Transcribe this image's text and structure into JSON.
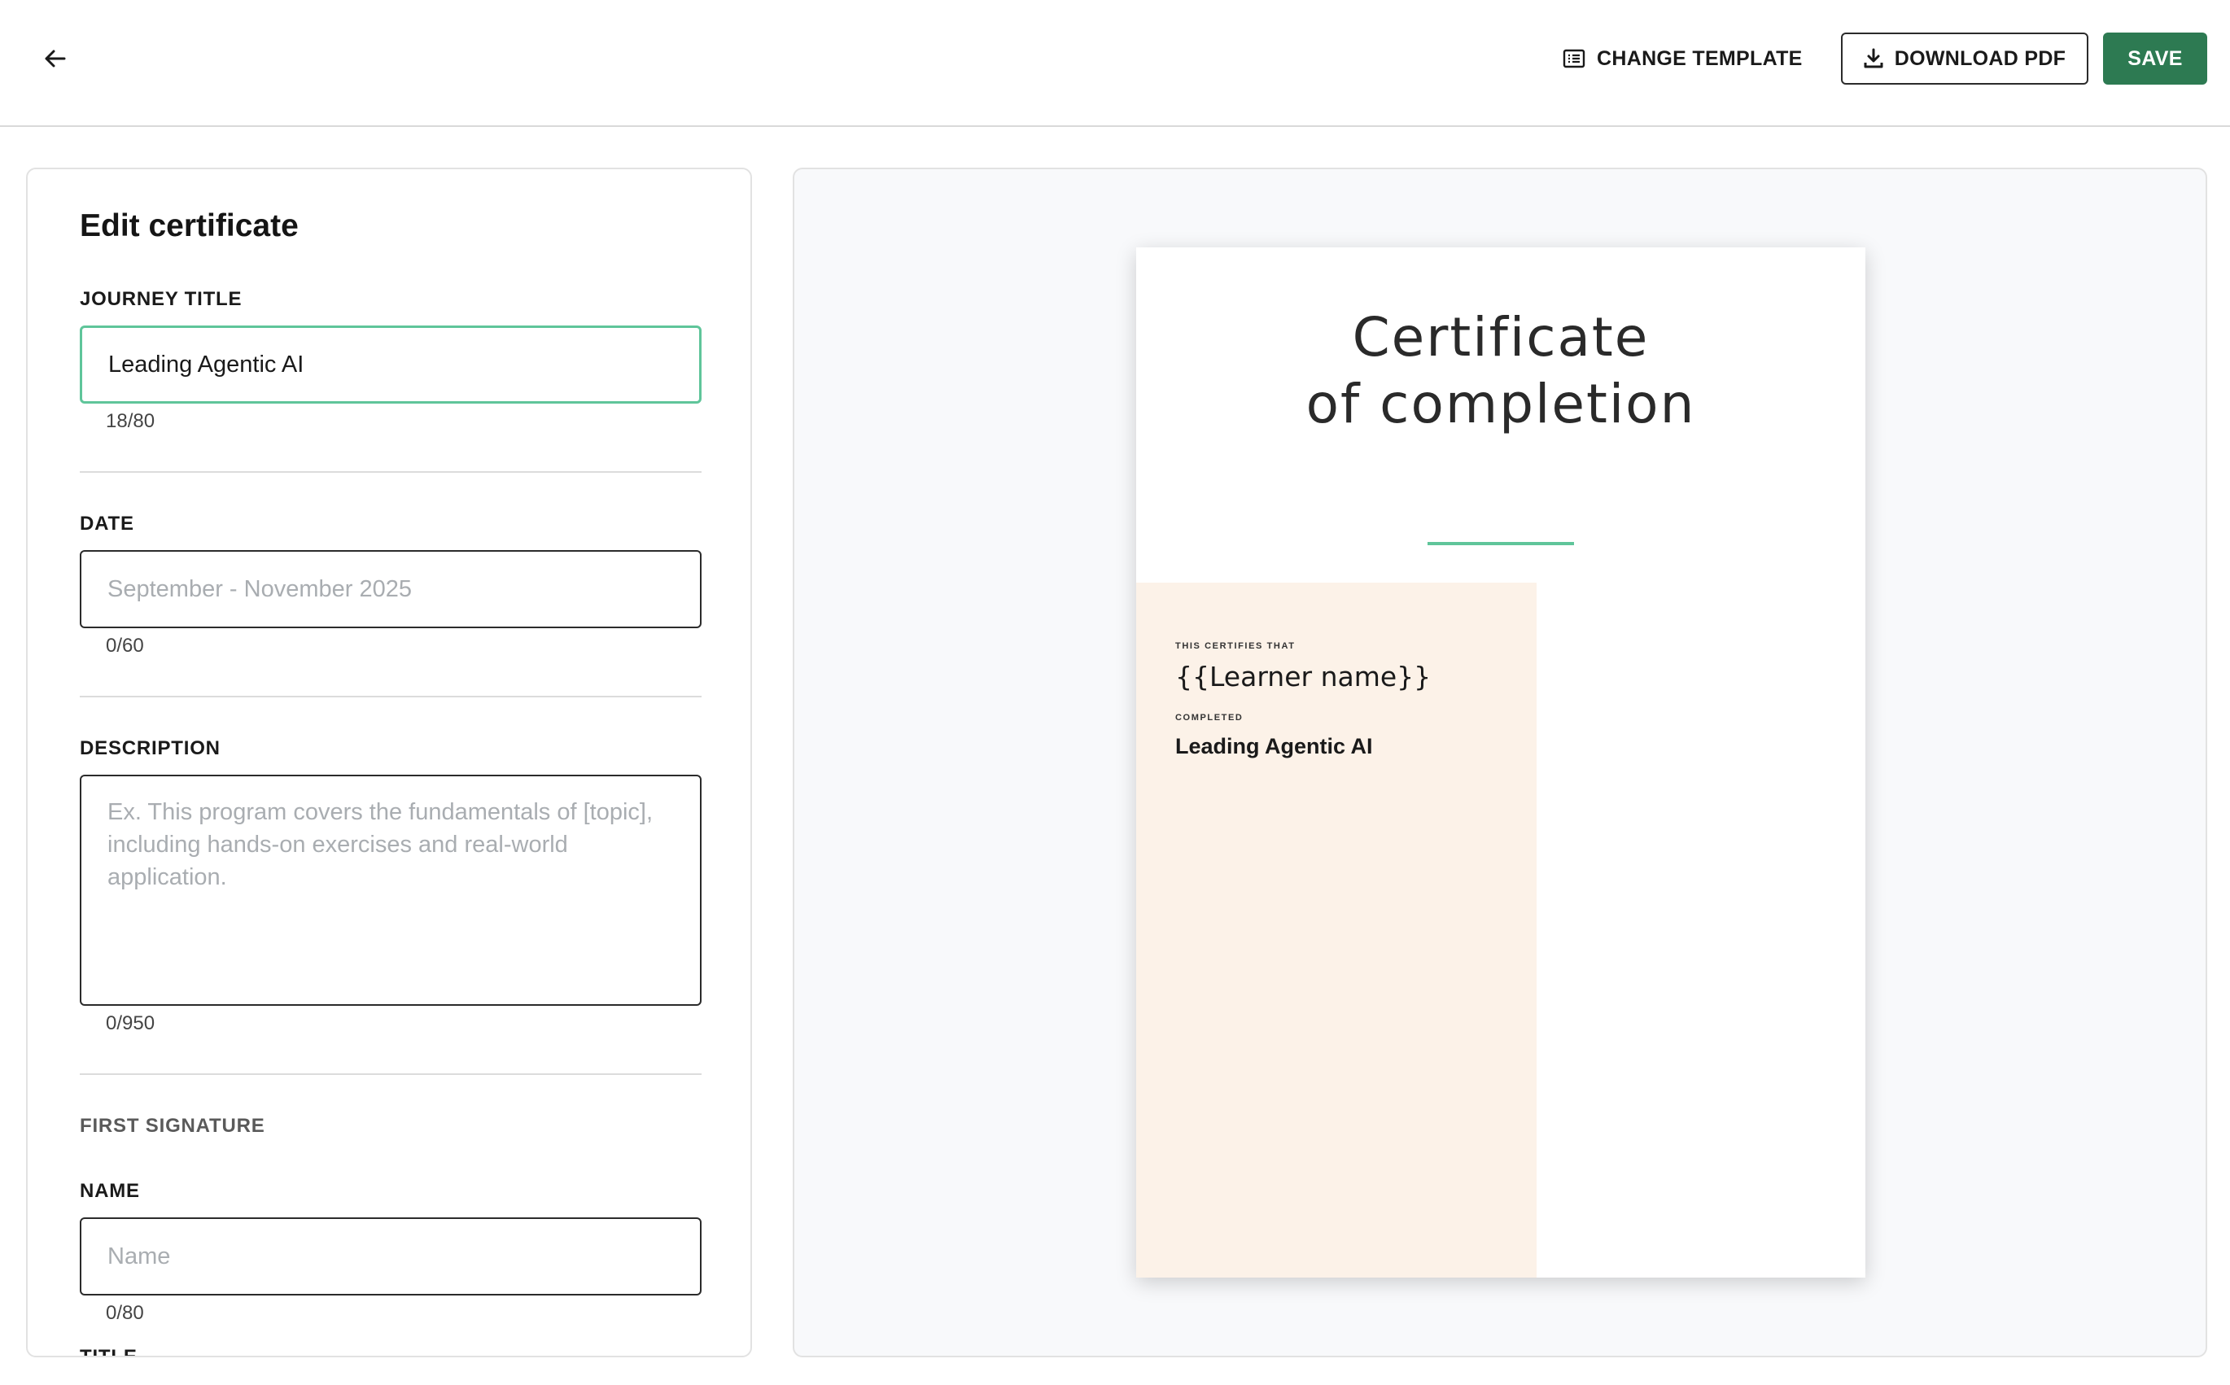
{
  "toolbar": {
    "change_template_label": "CHANGE TEMPLATE",
    "download_pdf_label": "DOWNLOAD PDF",
    "save_label": "SAVE",
    "accent_color": "#2d7a52"
  },
  "editor": {
    "heading": "Edit certificate",
    "journey_title": {
      "label": "JOURNEY TITLE",
      "value": "Leading Agentic AI",
      "counter": "18/80"
    },
    "date": {
      "label": "DATE",
      "placeholder": "September - November 2025",
      "counter": "0/60"
    },
    "description": {
      "label": "DESCRIPTION",
      "placeholder": "Ex. This program covers the fundamentals of [topic], including hands-on exercises and real-world application.",
      "counter": "0/950"
    },
    "first_signature": {
      "section_label": "FIRST SIGNATURE",
      "name_label": "NAME",
      "name_placeholder": "Name",
      "name_counter": "0/80",
      "next_label": "TITLE"
    }
  },
  "certificate": {
    "title_line1": "Certificate",
    "title_line2": "of completion",
    "certifies_label": "THIS CERTIFIES THAT",
    "learner_placeholder": "{{Learner name}}",
    "completed_label": "COMPLETED",
    "course_title": "Leading Agentic AI",
    "underline_color": "#5fc59a",
    "band_color": "#fcf2e8"
  }
}
